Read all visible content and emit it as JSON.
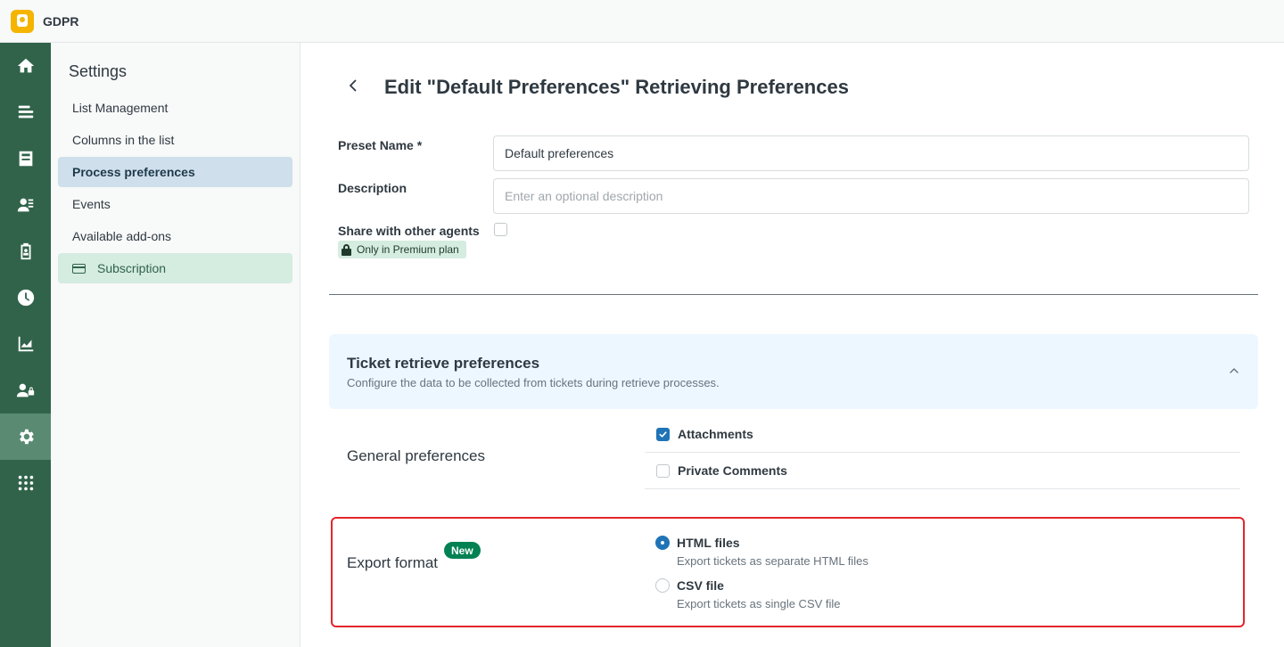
{
  "app": {
    "title": "GDPR"
  },
  "nav": {
    "items": [
      {
        "name": "nav-home",
        "icon": "home-icon"
      },
      {
        "name": "nav-lists",
        "icon": "list-icon"
      },
      {
        "name": "nav-tickets",
        "icon": "inbox-icon"
      },
      {
        "name": "nav-users",
        "icon": "user-icon"
      },
      {
        "name": "nav-clipboard",
        "icon": "clipboard-icon"
      },
      {
        "name": "nav-history",
        "icon": "clock-icon"
      },
      {
        "name": "nav-reports",
        "icon": "chart-icon"
      },
      {
        "name": "nav-agents",
        "icon": "user-lock-icon"
      },
      {
        "name": "nav-settings",
        "icon": "gear-icon",
        "active": true
      },
      {
        "name": "nav-apps",
        "icon": "grid-icon"
      }
    ]
  },
  "settings": {
    "title": "Settings",
    "items": [
      {
        "label": "List Management"
      },
      {
        "label": "Columns in the list"
      },
      {
        "label": "Process preferences",
        "active": true
      },
      {
        "label": "Events"
      },
      {
        "label": "Available add-ons"
      },
      {
        "label": "Subscription",
        "icon": "credit-card-icon"
      }
    ]
  },
  "page": {
    "title": "Edit \"Default Preferences\" Retrieving Preferences",
    "form": {
      "preset_name_label": "Preset Name *",
      "preset_name_value": "Default preferences",
      "description_label": "Description",
      "description_placeholder": "Enter an optional description",
      "share_label": "Share with other agents",
      "premium_badge": "Only in Premium plan"
    },
    "section": {
      "title": "Ticket retrieve preferences",
      "subtitle": "Configure the data to be collected from tickets during retrieve processes."
    },
    "general": {
      "label": "General preferences",
      "options": [
        {
          "label": "Attachments",
          "checked": true
        },
        {
          "label": "Private Comments",
          "checked": false
        }
      ]
    },
    "export": {
      "label": "Export format",
      "badge": "New",
      "options": [
        {
          "label": "HTML files",
          "hint": "Export tickets as separate HTML files",
          "selected": true
        },
        {
          "label": "CSV file",
          "hint": "Export tickets as single CSV file",
          "selected": false
        }
      ]
    }
  },
  "colors": {
    "nav_bg": "#30634a",
    "accent_blue": "#1f73b7",
    "highlight_red": "#e3262b",
    "new_badge_green": "#038153"
  }
}
